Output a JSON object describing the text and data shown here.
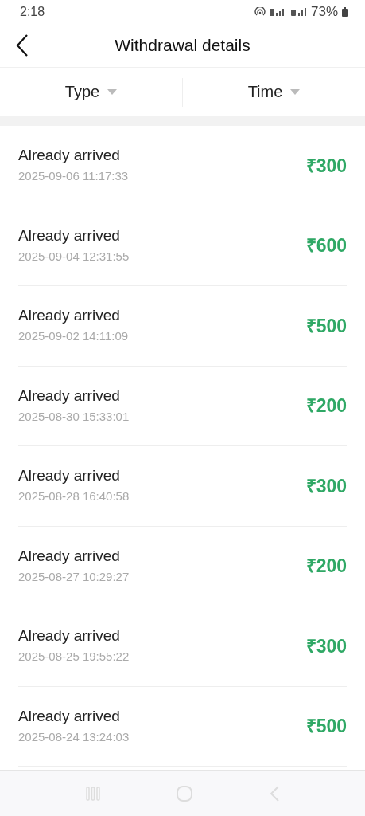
{
  "status_bar": {
    "time": "2:18",
    "battery": "73%"
  },
  "header": {
    "title": "Withdrawal details"
  },
  "filters": [
    {
      "label": "Type"
    },
    {
      "label": "Time"
    }
  ],
  "records": [
    {
      "status": "Already arrived",
      "time": "2025-09-06 11:17:33",
      "amount": "₹300"
    },
    {
      "status": "Already arrived",
      "time": "2025-09-04 12:31:55",
      "amount": "₹600"
    },
    {
      "status": "Already arrived",
      "time": "2025-09-02 14:11:09",
      "amount": "₹500"
    },
    {
      "status": "Already arrived",
      "time": "2025-08-30 15:33:01",
      "amount": "₹200"
    },
    {
      "status": "Already arrived",
      "time": "2025-08-28 16:40:58",
      "amount": "₹300"
    },
    {
      "status": "Already arrived",
      "time": "2025-08-27 10:29:27",
      "amount": "₹200"
    },
    {
      "status": "Already arrived",
      "time": "2025-08-25 19:55:22",
      "amount": "₹300"
    },
    {
      "status": "Already arrived",
      "time": "2025-08-24 13:24:03",
      "amount": "₹500"
    }
  ]
}
